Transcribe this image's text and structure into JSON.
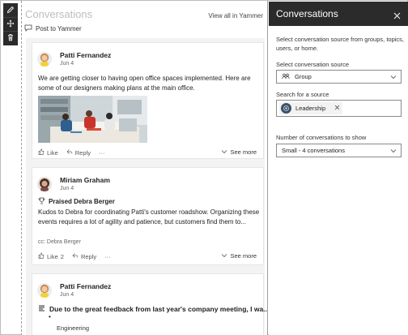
{
  "toolbar": {
    "icons": [
      "edit-icon",
      "move-icon",
      "delete-icon"
    ]
  },
  "webpart": {
    "title": "Conversations",
    "view_all": "View all in Yammer",
    "post_to_yammer": "Post to Yammer"
  },
  "posts": [
    {
      "author": "Patti Fernandez",
      "date": "Jun 4",
      "body": "We are getting closer to having open office spaces implemented. Here are some of our designers making plans at the main office.",
      "like": "Like",
      "reply": "Reply",
      "more": "···",
      "see_more": "See more"
    },
    {
      "author": "Miriam Graham",
      "date": "Jun 4",
      "praise": "Praised Debra Berger",
      "body": "Kudos to Debra for coordinating Patti's customer roadshow. Organizing these events requires a lot of agility and patience, but customers find them to...",
      "cc": "cc: Debra Berger",
      "like": "Like",
      "like_count": "2",
      "reply": "Reply",
      "more": "···",
      "see_more": "See more"
    },
    {
      "author": "Patti Fernandez",
      "date": "Jun 4",
      "title": "Due to the great feedback from last year's company meeting, I wa...",
      "bullet": "•",
      "group": "Engineering"
    }
  ],
  "pane": {
    "title": "Conversations",
    "description": "Select conversation source from groups, topics, users, or home.",
    "source_label": "Select conversation source",
    "source_value": "Group",
    "search_label": "Search for a source",
    "search_value": "Leadership",
    "count_label": "Number of conversations to show",
    "count_value": "Small - 4 conversations"
  },
  "colors": {
    "dark_bar": "#2b2b2b",
    "feed_bg": "#f3f3f3",
    "title_gray": "#bdbdbd"
  }
}
